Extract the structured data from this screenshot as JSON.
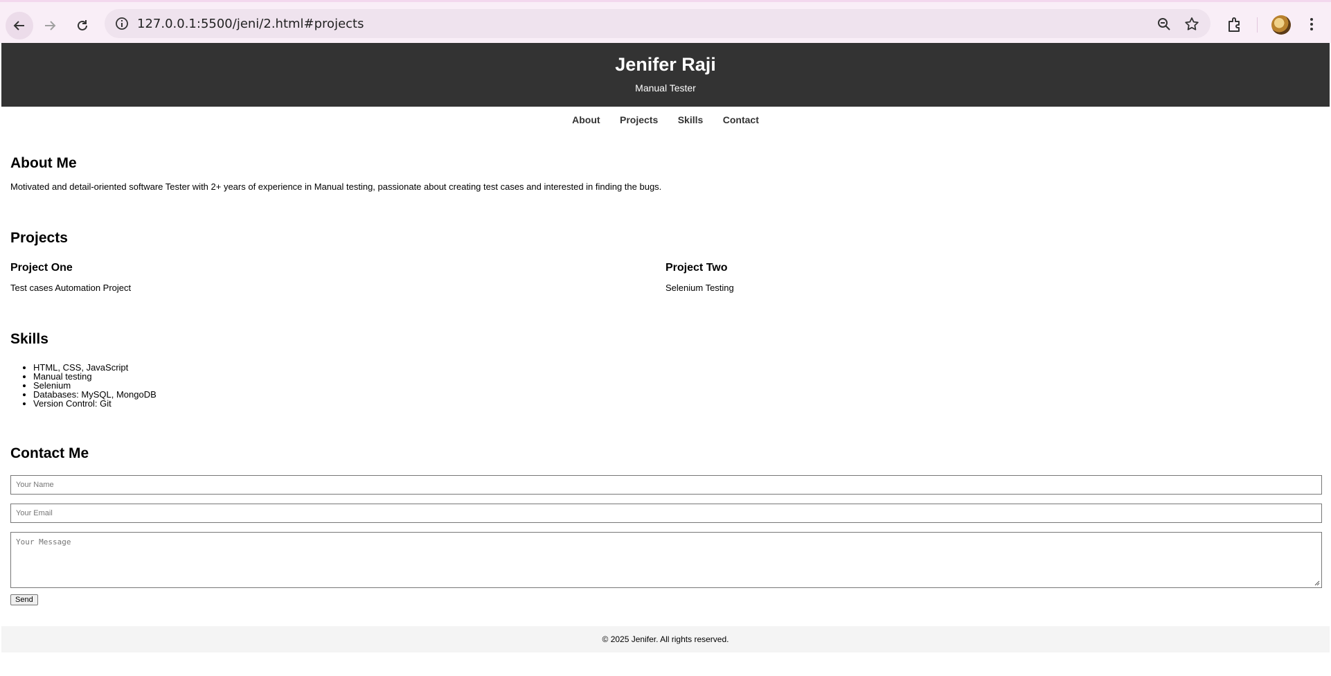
{
  "browser": {
    "url": "127.0.0.1:5500/jeni/2.html#projects"
  },
  "header": {
    "title": "Jenifer Raji",
    "subtitle": "Manual Tester"
  },
  "nav": {
    "items": [
      {
        "label": "About"
      },
      {
        "label": "Projects"
      },
      {
        "label": "Skills"
      },
      {
        "label": "Contact"
      }
    ]
  },
  "about": {
    "heading": "About Me",
    "text": "Motivated and detail-oriented software Tester with 2+ years of experience in Manual testing, passionate about creating test cases and interested in finding the bugs."
  },
  "projects": {
    "heading": "Projects",
    "items": [
      {
        "title": "Project One",
        "description": "Test cases Automation Project"
      },
      {
        "title": "Project Two",
        "description": "Selenium Testing"
      }
    ]
  },
  "skills": {
    "heading": "Skills",
    "items": [
      "HTML, CSS, JavaScript",
      "Manual testing",
      "Selenium",
      "Databases: MySQL, MongoDB",
      "Version Control: Git"
    ]
  },
  "contact": {
    "heading": "Contact Me",
    "name_placeholder": "Your Name",
    "email_placeholder": "Your Email",
    "message_placeholder": "Your Message",
    "send_label": "Send"
  },
  "footer": {
    "text": "© 2025 Jenifer. All rights reserved."
  },
  "colors": {
    "header_bg": "#333333",
    "footer_bg": "#f4f4f4",
    "chrome_bg": "#f9eef7"
  }
}
